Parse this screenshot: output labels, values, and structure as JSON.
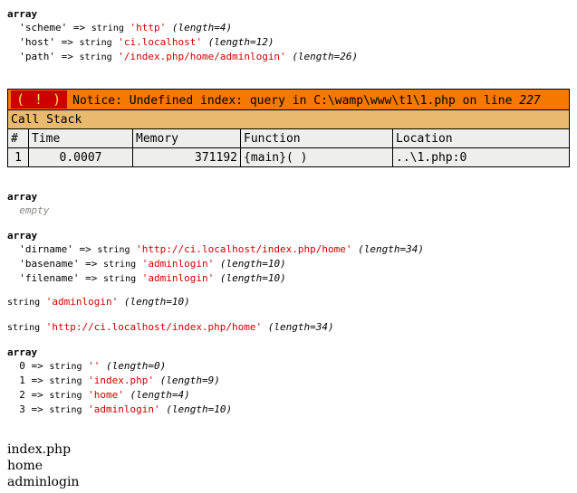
{
  "dump1": {
    "kw": "array",
    "entries": [
      {
        "key": "'scheme'",
        "arrow": "=>",
        "type": "string",
        "value": "'http'",
        "length": "(length=4)"
      },
      {
        "key": "'host'",
        "arrow": "=>",
        "type": "string",
        "value": "'ci.localhost'",
        "length": "(length=12)"
      },
      {
        "key": "'path'",
        "arrow": "=>",
        "type": "string",
        "value": "'/index.php/home/adminlogin'",
        "length": "(length=26)"
      }
    ]
  },
  "error": {
    "bang": "( ! )",
    "message": "Notice: Undefined index: query in C:\\wamp\\www\\t1\\1.php on line",
    "line": "227",
    "callstack_title": "Call Stack",
    "headers": [
      "#",
      "Time",
      "Memory",
      "Function",
      "Location"
    ],
    "rows": [
      {
        "num": "1",
        "time": "0.0007",
        "memory": "371192",
        "function": "{main}( )",
        "location": "..\\1.php:0"
      }
    ]
  },
  "dump2": {
    "kw": "array",
    "empty": "empty"
  },
  "dump3": {
    "kw": "array",
    "entries": [
      {
        "key": "'dirname'",
        "arrow": "=>",
        "type": "string",
        "value": "'http://ci.localhost/index.php/home'",
        "length": "(length=34)"
      },
      {
        "key": "'basename'",
        "arrow": "=>",
        "type": "string",
        "value": "'adminlogin'",
        "length": "(length=10)"
      },
      {
        "key": "'filename'",
        "arrow": "=>",
        "type": "string",
        "value": "'adminlogin'",
        "length": "(length=10)"
      }
    ]
  },
  "dump4": {
    "type": "string",
    "value": "'adminlogin'",
    "length": "(length=10)"
  },
  "dump5": {
    "type": "string",
    "value": "'http://ci.localhost/index.php/home'",
    "length": "(length=34)"
  },
  "dump6": {
    "kw": "array",
    "entries": [
      {
        "key": "0",
        "arrow": "=>",
        "type": "string",
        "value": "''",
        "length": "(length=0)"
      },
      {
        "key": "1",
        "arrow": "=>",
        "type": "string",
        "value": "'index.php'",
        "length": "(length=9)"
      },
      {
        "key": "2",
        "arrow": "=>",
        "type": "string",
        "value": "'home'",
        "length": "(length=4)"
      },
      {
        "key": "3",
        "arrow": "=>",
        "type": "string",
        "value": "'adminlogin'",
        "length": "(length=10)"
      }
    ]
  },
  "plain_output": [
    "index.php",
    "home",
    "adminlogin"
  ],
  "colors": {
    "string_value": "#cc0000",
    "notice_bg": "#f57900",
    "bang_bg": "#cc0000",
    "callstack_bg": "#e9b96e",
    "table_bg": "#eeeeec",
    "empty_text": "#888a85"
  }
}
